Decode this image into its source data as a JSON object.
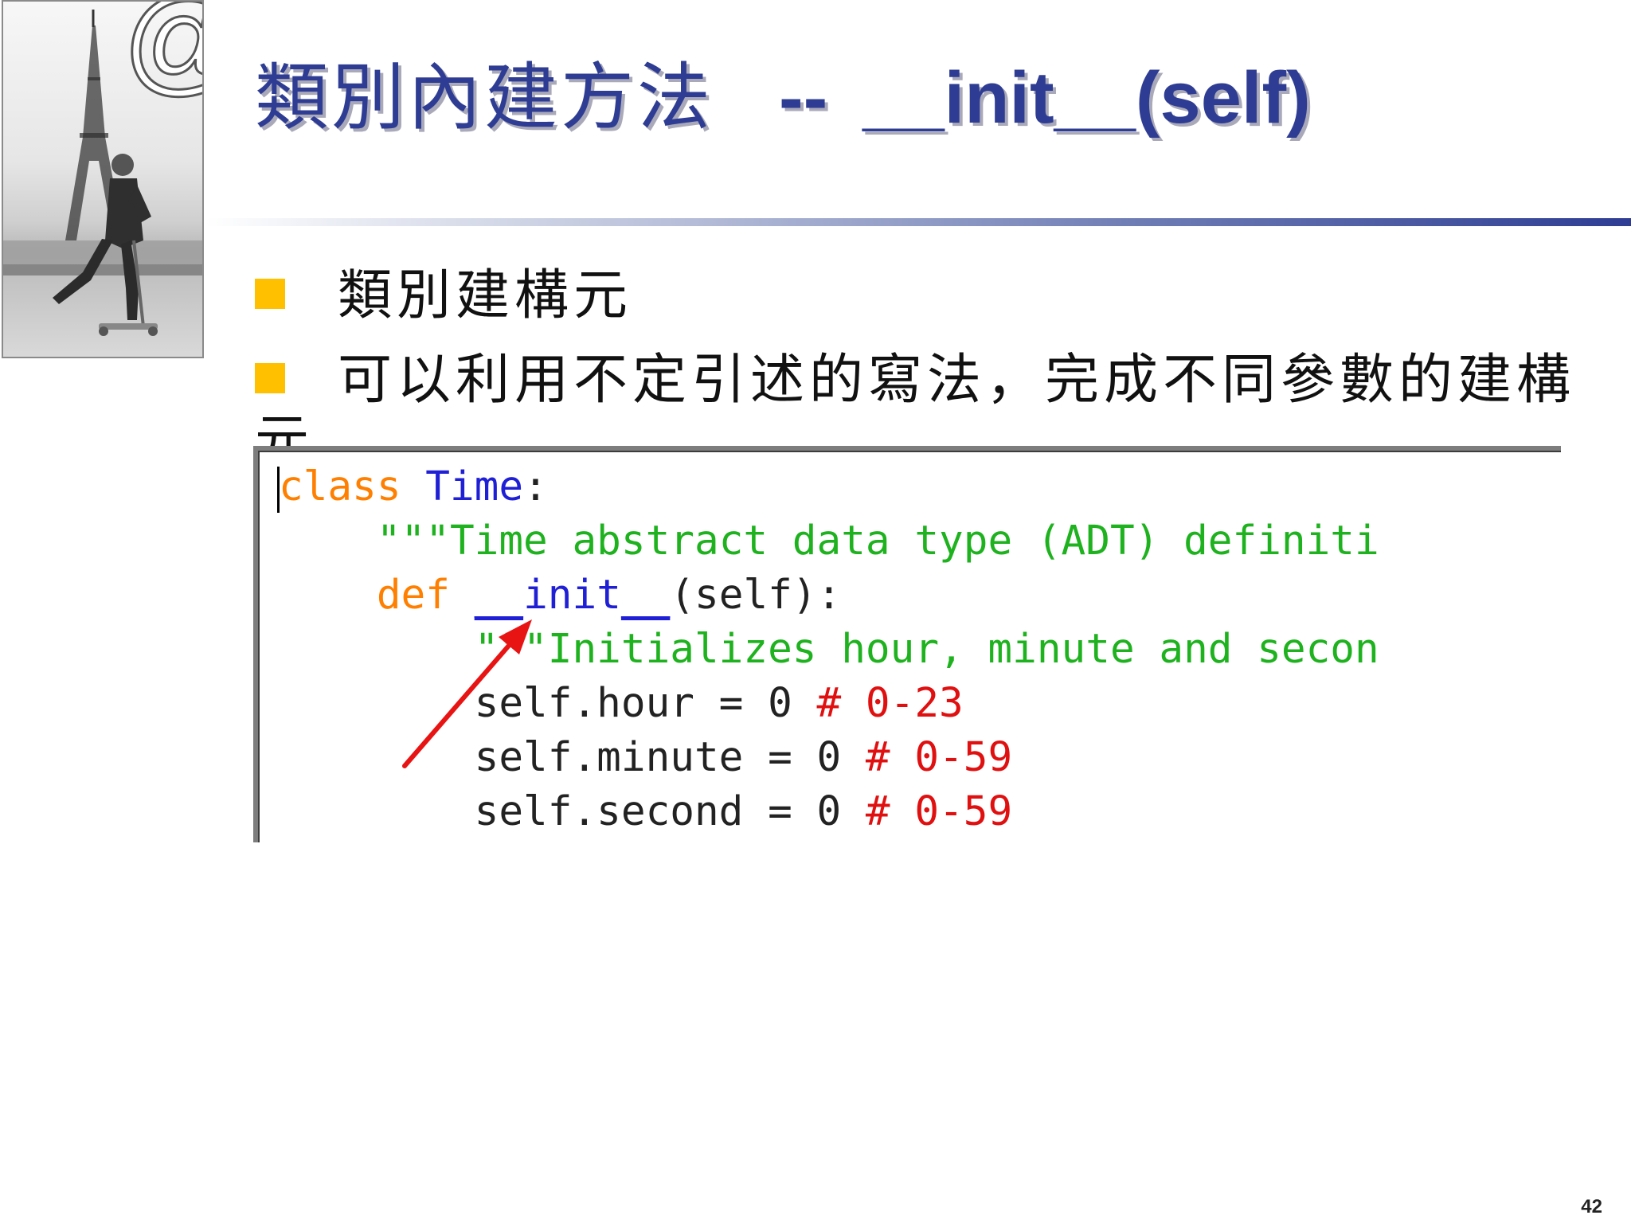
{
  "slide": {
    "title_cjk": "類別內建方法",
    "title_dash": "--",
    "title_method": "__init__(self)",
    "bullets": [
      "類別建構元",
      "可以利用不定引述的寫法，完成不同參數的建構"
    ],
    "bullet_wrap": "元",
    "page_number": "42",
    "decor_symbol": "@"
  },
  "code": {
    "line1": {
      "kw": "class",
      "name": "Time",
      "rest": ":"
    },
    "line2": {
      "string": "\"\"\"Time abstract data type (ADT) definiti"
    },
    "line3": {
      "kw": "def",
      "u1": "__",
      "name": "init",
      "u2": "__",
      "rest": "(self):"
    },
    "line4": {
      "string": "\"\"\"Initializes hour, minute and secon"
    },
    "line5": {
      "code": "self.hour = 0 ",
      "comment": "# 0-23"
    },
    "line6": {
      "code": "self.minute = 0 ",
      "comment": "# 0-59"
    },
    "line7": {
      "code": "self.second = 0 ",
      "comment": "# 0-59"
    }
  },
  "colors": {
    "title": "#2e3d93",
    "bullet": "#ffc000",
    "keyword": "#ff7f00",
    "name": "#1f1fd6",
    "string": "#1fb21f",
    "comment": "#e01010",
    "arrow": "#e81414"
  }
}
